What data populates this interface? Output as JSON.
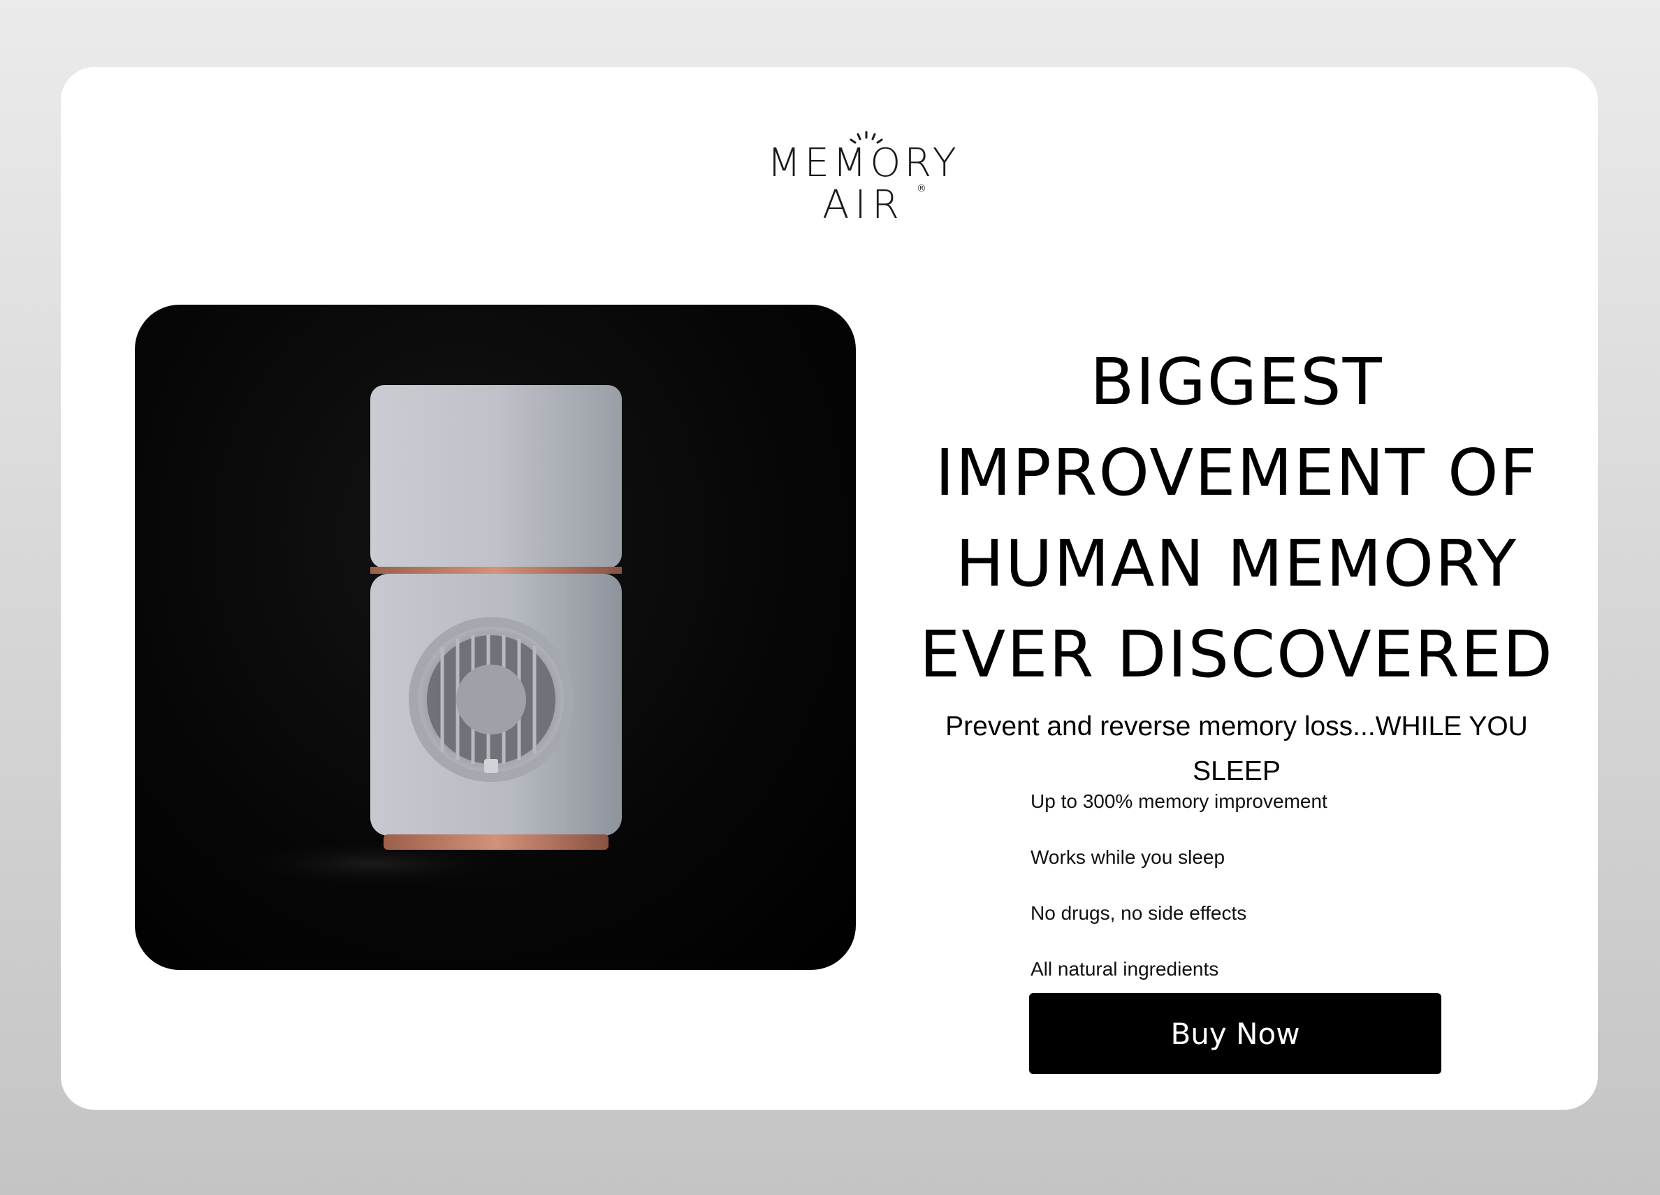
{
  "brand": {
    "logo_line1": "MEMORY",
    "logo_line2": "AIR",
    "registered_mark": "®"
  },
  "hero": {
    "headline": "BIGGEST IMPROVEMENT OF HUMAN MEMORY EVER DISCOVERED",
    "subheadline": "Prevent and reverse memory loss...WHILE YOU SLEEP",
    "benefits": [
      "Up to 300% memory improvement",
      "Works while you sleep",
      "No drugs, no side effects",
      "All natural ingredients"
    ],
    "cta_label": "Buy Now"
  },
  "product_image": {
    "description_icon": "air-purifier-device-image"
  },
  "colors": {
    "page_background": "#d9d9d9",
    "card_background": "#ffffff",
    "product_background": "#000000",
    "device_body": "#b9bcc3",
    "copper_accent": "#c0826a",
    "button_background": "#000000",
    "button_text": "#ffffff"
  }
}
